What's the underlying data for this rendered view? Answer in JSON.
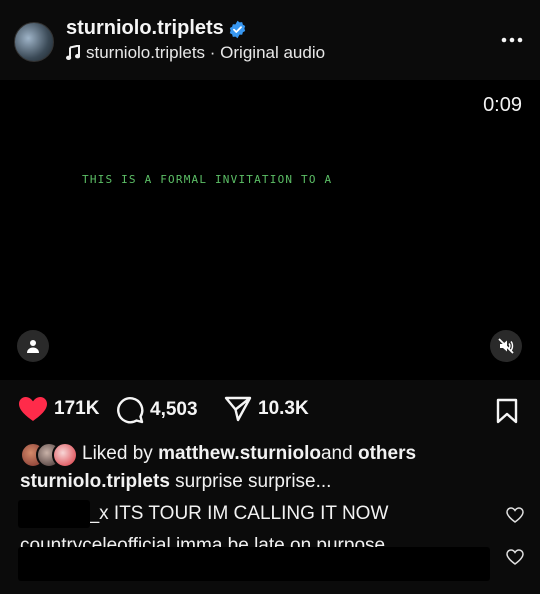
{
  "header": {
    "username": "sturniolo.triplets",
    "audio_user": "sturniolo.triplets",
    "audio_sep": " · ",
    "audio_label": "Original audio",
    "verified_icon": "verified-badge-icon",
    "more_icon": "more-options-icon"
  },
  "video": {
    "timer": "0:09",
    "caption": "THIS IS A FORMAL INVITATION TO A",
    "caption_color": "#5cbf66",
    "muted": true
  },
  "actions": {
    "likes": "171K",
    "comments": "4,503",
    "shares": "10.3K",
    "like_color": "#ff2b4a"
  },
  "likes_line": {
    "prefix": "Liked by ",
    "user": "matthew.sturniolo",
    "middle": " and ",
    "others": "others"
  },
  "caption_line": {
    "user": "sturniolo.triplets",
    "text": " surprise surprise..."
  },
  "comments": [
    {
      "user_visible": "3_x",
      "text": " ITS TOUR IM CALLING IT NOW"
    },
    {
      "text": "countryceleofficial imma be late on purpose"
    }
  ]
}
